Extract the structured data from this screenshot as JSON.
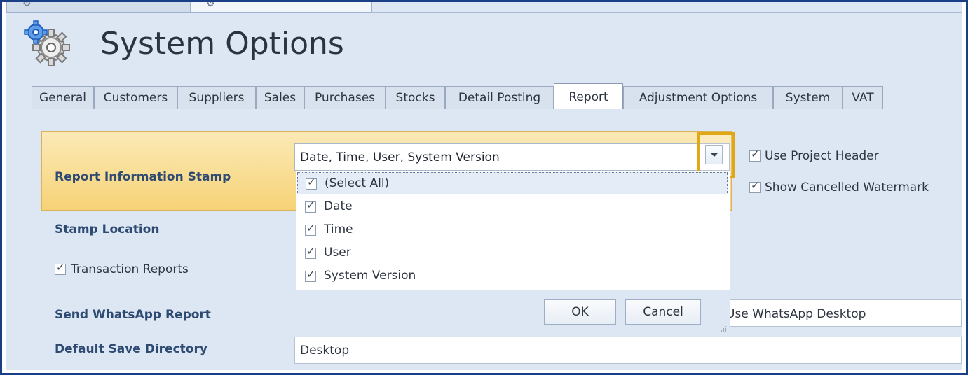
{
  "window": {
    "title": "System Options"
  },
  "tabs": [
    {
      "label": "General"
    },
    {
      "label": "Customers"
    },
    {
      "label": "Suppliers"
    },
    {
      "label": "Sales"
    },
    {
      "label": "Purchases"
    },
    {
      "label": "Stocks"
    },
    {
      "label": "Detail Posting"
    },
    {
      "label": "Report",
      "active": true
    },
    {
      "label": "Adjustment Options"
    },
    {
      "label": "System"
    },
    {
      "label": "VAT"
    }
  ],
  "report": {
    "stamp_label": "Report Information Stamp",
    "stamp_value": "Date, Time, User, System Version",
    "stamp_location_label": "Stamp Location",
    "transaction_reports_label": "Transaction Reports",
    "transaction_reports_checked": true,
    "use_project_header_label": "Use Project Header",
    "use_project_header_checked": true,
    "show_cancelled_watermark_label": "Show Cancelled Watermark",
    "show_cancelled_watermark_checked": true,
    "send_whatsapp_label": "Send WhatsApp Report",
    "send_whatsapp_value": "Use WhatsApp Desktop",
    "default_save_directory_label": "Default Save Directory",
    "default_save_directory_value": "Desktop"
  },
  "dropdown": {
    "items": [
      {
        "label": "(Select All)",
        "checked": true,
        "selected": true
      },
      {
        "label": "Date",
        "checked": true
      },
      {
        "label": "Time",
        "checked": true
      },
      {
        "label": "User",
        "checked": true
      },
      {
        "label": "System Version",
        "checked": true
      }
    ],
    "ok_label": "OK",
    "cancel_label": "Cancel"
  },
  "colors": {
    "frame_border": "#1b3f86",
    "highlight_top": "#fbe9b6",
    "highlight_bottom": "#f7d377",
    "dropdown_highlight": "#e0a816",
    "label_blue": "#2d4a72"
  },
  "icons": [
    "gear-icon",
    "chevron-down-icon",
    "checkbox-check-icon",
    "resize-grip-icon"
  ]
}
